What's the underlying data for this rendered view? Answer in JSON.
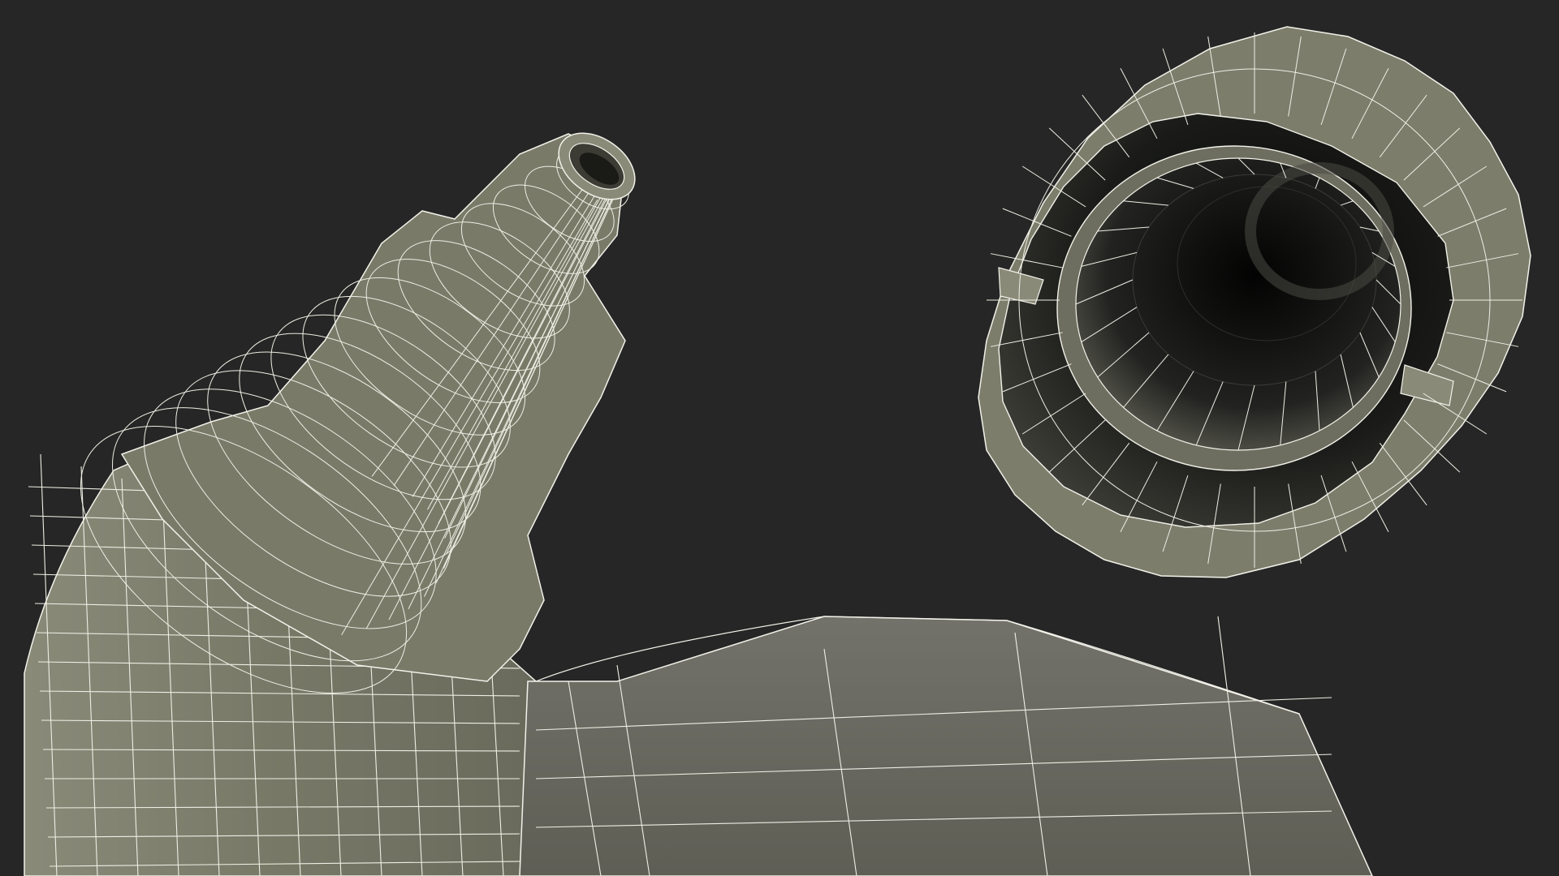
{
  "scene": {
    "background": "#262626",
    "mesh_fill": "#787867",
    "mesh_fill_light": "#8a8a79",
    "mesh_fill_dark": "#55554b",
    "wire_color": "#f2f2ea",
    "cavity_color": "#0d0e0c",
    "objects": [
      "tube-body-wireframe",
      "tube-nozzle-wireframe",
      "cap-wireframe"
    ]
  }
}
